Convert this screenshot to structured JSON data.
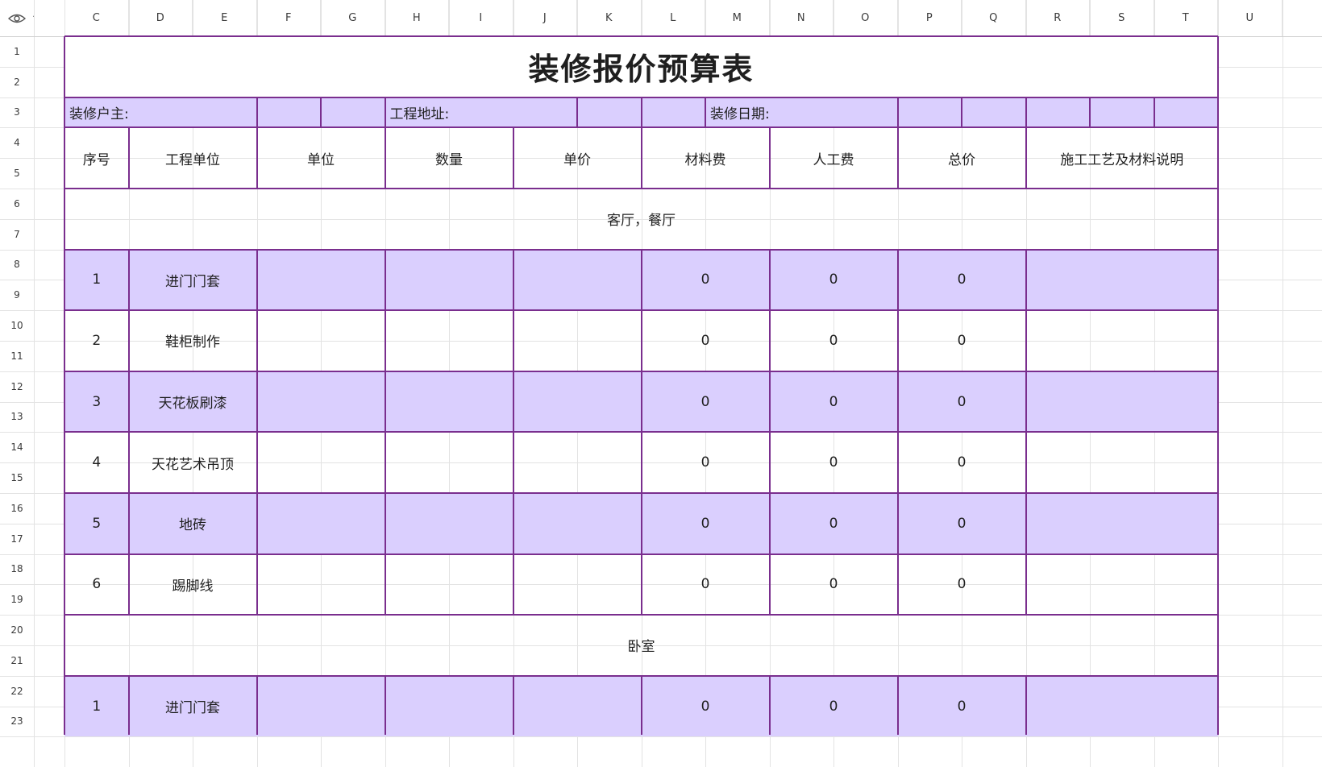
{
  "columns": [
    "C",
    "D",
    "E",
    "F",
    "G",
    "H",
    "I",
    "J",
    "K",
    "L",
    "M",
    "N",
    "O",
    "P",
    "Q",
    "R",
    "S",
    "T",
    "U"
  ],
  "rows": [
    "1",
    "2",
    "3",
    "4",
    "5",
    "6",
    "7",
    "8",
    "9",
    "10",
    "11",
    "12",
    "13",
    "14",
    "15",
    "16",
    "17",
    "18",
    "19",
    "20",
    "21",
    "22",
    "23"
  ],
  "title": "装修报价预算表",
  "info": {
    "owner_label": "装修户主:",
    "address_label": "工程地址:",
    "date_label": "装修日期:"
  },
  "headers": [
    "序号",
    "工程单位",
    "单位",
    "数量",
    "单价",
    "材料费",
    "人工费",
    "总价",
    "施工工艺及材料说明"
  ],
  "section1": "客厅，餐厅",
  "section2": "卧室",
  "items": [
    {
      "no": "1",
      "name": "进门门套",
      "material": "0",
      "labor": "0",
      "total": "0"
    },
    {
      "no": "2",
      "name": "鞋柜制作",
      "material": "0",
      "labor": "0",
      "total": "0"
    },
    {
      "no": "3",
      "name": "天花板刷漆",
      "material": "0",
      "labor": "0",
      "total": "0"
    },
    {
      "no": "4",
      "name": "天花艺术吊顶",
      "material": "0",
      "labor": "0",
      "total": "0"
    },
    {
      "no": "5",
      "name": "地砖",
      "material": "0",
      "labor": "0",
      "total": "0"
    },
    {
      "no": "6",
      "name": "踢脚线",
      "material": "0",
      "labor": "0",
      "total": "0"
    }
  ],
  "items2": [
    {
      "no": "1",
      "name": "进门门套",
      "material": "0",
      "labor": "0",
      "total": "0"
    }
  ],
  "colors": {
    "accent": "#7a2e8e",
    "fill": "#dacffe",
    "grid": "#e3e3e3"
  },
  "icons": {
    "visibility": "eye-icon"
  }
}
